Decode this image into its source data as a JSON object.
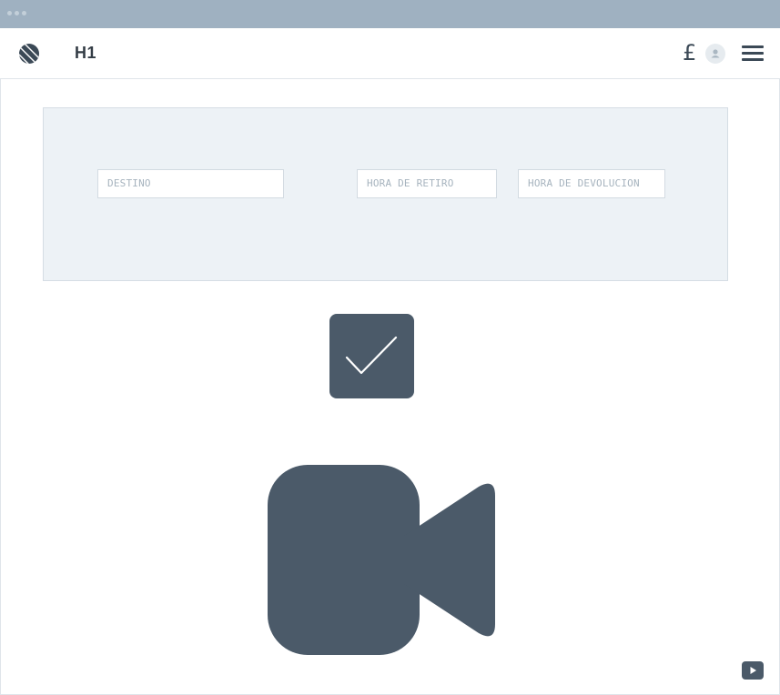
{
  "header": {
    "title": "H1",
    "currency_symbol": "£",
    "logo_icon": "globe-logo-icon",
    "avatar_icon": "user-avatar-icon",
    "menu_icon": "hamburger-menu-icon"
  },
  "search_panel": {
    "destination_placeholder": "DESTINO",
    "pickup_time_placeholder": "HORA DE RETIRO",
    "return_time_placeholder": "HORA DE DEVOLUCION"
  },
  "media": {
    "checkbox_icon": "checkmark-icon",
    "camera_icon": "video-camera-icon",
    "youtube_icon": "youtube-play-icon"
  },
  "colors": {
    "titlebar": "#9fb1c1",
    "panel_background": "#edf2f6",
    "icon_dark": "#4b5a69"
  }
}
